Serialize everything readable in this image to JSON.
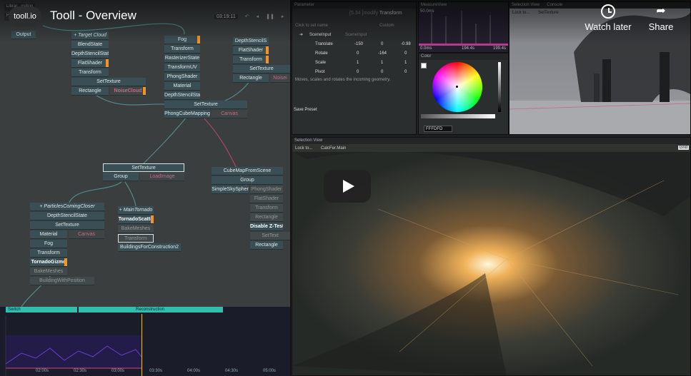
{
  "video": {
    "channel_label": "tooll.io",
    "title": "Tooll - Overview",
    "actions": {
      "watch_later": "Watch later",
      "share": "Share"
    }
  },
  "graph": {
    "tabs": [
      "Librar",
      "osition",
      "Ho",
      "tain"
    ],
    "toolbar": {
      "timecode": "03:19:11"
    },
    "nodes": [
      "Output",
      "+ Target Cloud",
      "BlendState",
      "DepthStencilState",
      "FlatShader",
      "Transform",
      "SetTexture",
      "Rectangle",
      "NoiseCloud",
      "Fog",
      "Transform",
      "RasterizerState",
      "TransformUV",
      "PhongShader",
      "Material",
      "DepthStencilState",
      "SetTexture",
      "PhongCubeMapping",
      "Canvas",
      "DepthStencilS",
      "FlatShader",
      "Transform",
      "SetTexture",
      "Rectangle",
      "Noisei",
      "SetTexture",
      "Group",
      "LoadImage",
      "CubeMapFromScene",
      "Group",
      "SimpleSkySpher",
      "PhongShader",
      "FlatShader",
      "Transform",
      "Rectangle",
      "Disable Z-Test",
      "SetText",
      "Rectangle",
      "+ ParticlesComingCloser",
      "DepthStencilState",
      "SetTexture",
      "Material",
      "Canvas",
      "Fog",
      "Transform",
      "TornadoGizmo",
      "BakeMeshes",
      "BuildingWithPosition",
      "+ MainTornado",
      "TornadoScatte",
      "BakeMeshes",
      "Transform",
      "BuildingsForConstruction2"
    ]
  },
  "timeline": {
    "tracks": [
      "Switch",
      "Reconstruction"
    ],
    "ticks": [
      "02:00s",
      "02:30s",
      "03:00s",
      "03:30s",
      "04:00s",
      "04:30s",
      "05:00s"
    ]
  },
  "parameter": {
    "title": "Parameter",
    "op_name": "Transform",
    "op_prefix": "[5.34 ]modify",
    "hint": "Click to set name",
    "custom": "Custom",
    "input_row": "SceneInput",
    "input_val": "SceneInput",
    "rows": [
      {
        "name": "Translate",
        "x": "-150",
        "y": "0",
        "z": "-0.98"
      },
      {
        "name": "Rotate",
        "x": "0",
        "y": "-164",
        "z": "0"
      },
      {
        "name": "Scale",
        "x": "1",
        "y": "1",
        "z": "1"
      },
      {
        "name": "Pivot",
        "x": "0",
        "y": "0",
        "z": "0"
      }
    ],
    "description": "Moves, scales and rotates the incoming geometry.",
    "preset": "Save Preset"
  },
  "measure": {
    "title": "MeasureView",
    "top_label": "50.0ms",
    "bottom_label": "0.0ms",
    "stat1": "194.4s",
    "stat2": "199.4s"
  },
  "color": {
    "title": "Color",
    "hex": "FFFDFD",
    "accent": "#ffffff"
  },
  "selection_top": {
    "title": "Selection View",
    "console": "Console",
    "lock": "Lock to...",
    "camera": "SetTexture"
  },
  "selection_main": {
    "title": "Selection View",
    "lock": "Lock to...",
    "camera": "CalcFer.Main",
    "gizmo": "Grid"
  },
  "colors": {
    "wire": "#4f8a8a",
    "wire_pink": "#a8476a",
    "node": "#3a4f55",
    "port": "#f0932b",
    "track": "#2fbfae",
    "playhead": "#e3c14d"
  }
}
